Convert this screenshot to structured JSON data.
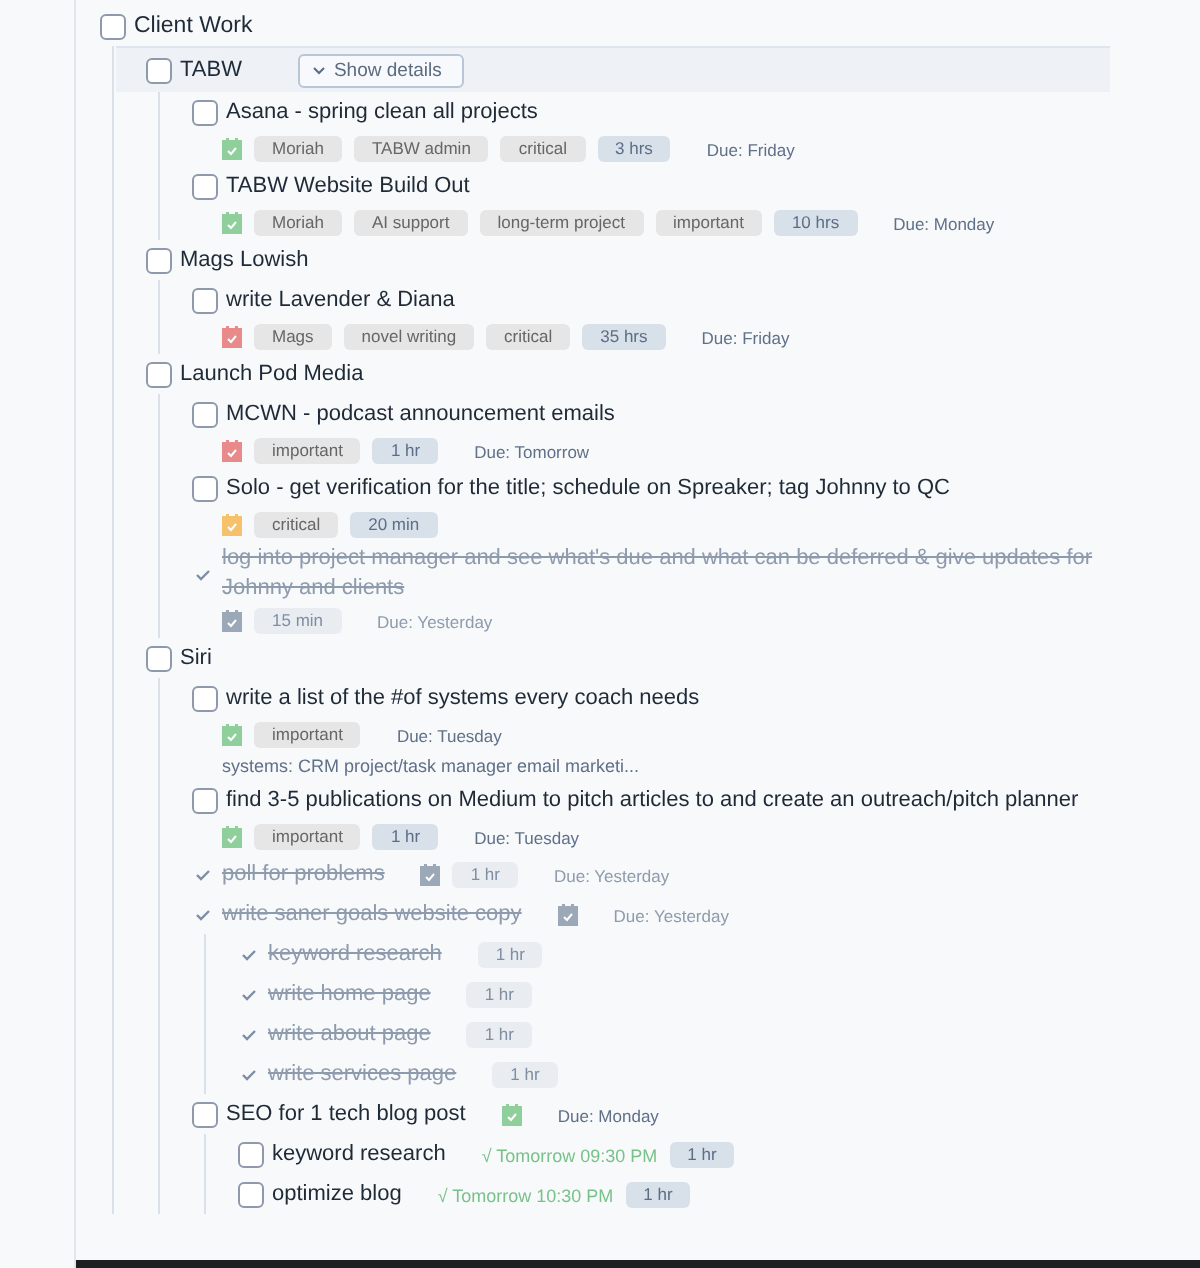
{
  "tree": {
    "title": "Client Work",
    "done": false,
    "selected": false,
    "children": [
      {
        "title": "TABW",
        "done": false,
        "selected": true,
        "details_button": "Show details",
        "children": [
          {
            "title": "Asana - spring clean all projects",
            "done": false,
            "selected": false,
            "color": "#8fcf9b",
            "tags": [
              {
                "text": "Moriah",
                "kind": "label"
              },
              {
                "text": "TABW admin",
                "kind": "label"
              },
              {
                "text": "critical",
                "kind": "label"
              },
              {
                "text": "3 hrs",
                "kind": "time"
              }
            ],
            "due": "Due: Friday"
          },
          {
            "title": "TABW Website Build Out",
            "done": false,
            "selected": false,
            "color": "#8fcf9b",
            "tags": [
              {
                "text": "Moriah",
                "kind": "label"
              },
              {
                "text": "AI support",
                "kind": "label"
              },
              {
                "text": "long-term project",
                "kind": "label"
              },
              {
                "text": "important",
                "kind": "label"
              },
              {
                "text": "10 hrs",
                "kind": "time"
              }
            ],
            "due": "Due: Monday"
          }
        ]
      },
      {
        "title": "Mags Lowish",
        "done": false,
        "selected": false,
        "children": [
          {
            "title": "write Lavender & Diana",
            "done": false,
            "selected": false,
            "color": "#e88a8a",
            "tags": [
              {
                "text": "Mags",
                "kind": "label"
              },
              {
                "text": "novel writing",
                "kind": "label"
              },
              {
                "text": "critical",
                "kind": "label"
              },
              {
                "text": "35 hrs",
                "kind": "time"
              }
            ],
            "due": "Due: Friday"
          }
        ]
      },
      {
        "title": "Launch Pod Media",
        "done": false,
        "selected": false,
        "children": [
          {
            "title": "MCWN - podcast announcement emails",
            "done": false,
            "selected": false,
            "color": "#e88a8a",
            "tags": [
              {
                "text": "important",
                "kind": "label"
              },
              {
                "text": "1 hr",
                "kind": "time"
              }
            ],
            "due": "Due: Tomorrow"
          },
          {
            "title": "Solo - get verification for the title; schedule on Spreaker; tag Johnny to QC",
            "done": false,
            "selected": false,
            "color": "#f5c26b",
            "tags": [
              {
                "text": "critical",
                "kind": "label"
              },
              {
                "text": "20 min",
                "kind": "time"
              }
            ]
          },
          {
            "title": "log into project manager and see what's due and what can be deferred & give updates for Johnny and clients",
            "done": true,
            "selected": false,
            "color": "#9aa8b8",
            "tags": [
              {
                "text": "15 min",
                "kind": "time"
              }
            ],
            "due": "Due: Yesterday"
          }
        ]
      },
      {
        "title": "Siri",
        "done": false,
        "selected": false,
        "children": [
          {
            "title": "write a list of the #of systems every coach needs",
            "done": false,
            "selected": false,
            "color": "#8fcf9b",
            "tags": [
              {
                "text": "important",
                "kind": "label"
              }
            ],
            "due": "Due: Tuesday",
            "note": "systems: CRM project/task manager email marketi..."
          },
          {
            "title": "find 3-5 publications on Medium to pitch articles to and create an outreach/pitch planner",
            "done": false,
            "selected": false,
            "color": "#8fcf9b",
            "tags": [
              {
                "text": "important",
                "kind": "label"
              },
              {
                "text": "1 hr",
                "kind": "time"
              }
            ],
            "due": "Due: Tuesday"
          },
          {
            "title": "poll for problems",
            "done": true,
            "selected": false,
            "inline": true,
            "color": "#9aa8b8",
            "tags": [
              {
                "text": "1 hr",
                "kind": "time"
              }
            ],
            "due": "Due: Yesterday"
          },
          {
            "title": "write saner goals website copy",
            "done": true,
            "selected": false,
            "inline": true,
            "color": "#9aa8b8",
            "due": "Due: Yesterday",
            "children": [
              {
                "title": "keyword research",
                "done": true,
                "selected": false,
                "inline": true,
                "tags": [
                  {
                    "text": "1 hr",
                    "kind": "time"
                  }
                ]
              },
              {
                "title": "write home page",
                "done": true,
                "selected": false,
                "inline": true,
                "tags": [
                  {
                    "text": "1 hr",
                    "kind": "time"
                  }
                ]
              },
              {
                "title": "write about page",
                "done": true,
                "selected": false,
                "inline": true,
                "tags": [
                  {
                    "text": "1 hr",
                    "kind": "time"
                  }
                ]
              },
              {
                "title": "write services page",
                "done": true,
                "selected": false,
                "inline": true,
                "tags": [
                  {
                    "text": "1 hr",
                    "kind": "time"
                  }
                ]
              }
            ]
          },
          {
            "title": "SEO for 1 tech blog post",
            "done": false,
            "selected": false,
            "inline": true,
            "color": "#8fcf9b",
            "due": "Due: Monday",
            "children": [
              {
                "title": "keyword research",
                "done": false,
                "selected": false,
                "inline": true,
                "reminder": "√ Tomorrow 09:30 PM",
                "tags": [
                  {
                    "text": "1 hr",
                    "kind": "time"
                  }
                ]
              },
              {
                "title": "optimize blog",
                "done": false,
                "selected": false,
                "inline": true,
                "reminder": "√ Tomorrow 10:30 PM",
                "tags": [
                  {
                    "text": "1 hr",
                    "kind": "time"
                  }
                ]
              }
            ]
          }
        ]
      }
    ]
  }
}
